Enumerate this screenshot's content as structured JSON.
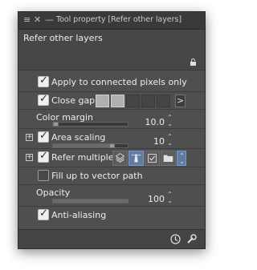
{
  "titlebar": {
    "title": "Tool property [Refer other layers]"
  },
  "header": {
    "title": "Refer other layers"
  },
  "settings": {
    "apply_connected": {
      "label": "Apply to connected pixels only",
      "checked": true
    },
    "close_gap": {
      "label": "Close gap",
      "checked": true
    },
    "color_margin": {
      "label": "Color margin",
      "value": "10.0",
      "level": 0.05
    },
    "area_scaling": {
      "label": "Area scaling",
      "checked": true,
      "value": "10",
      "level": 0.78
    },
    "refer_multiple": {
      "label": "Refer multiple",
      "checked": true
    },
    "fill_vector": {
      "label": "Fill up to vector path",
      "checked": false
    },
    "opacity": {
      "label": "Opacity",
      "value": "100",
      "level": 1.0
    },
    "anti_aliasing": {
      "label": "Anti-aliasing",
      "checked": true
    }
  },
  "colors": {
    "panel": "#4f4f4f",
    "accent": "#5f7da4",
    "check": "#f0f0f0"
  }
}
